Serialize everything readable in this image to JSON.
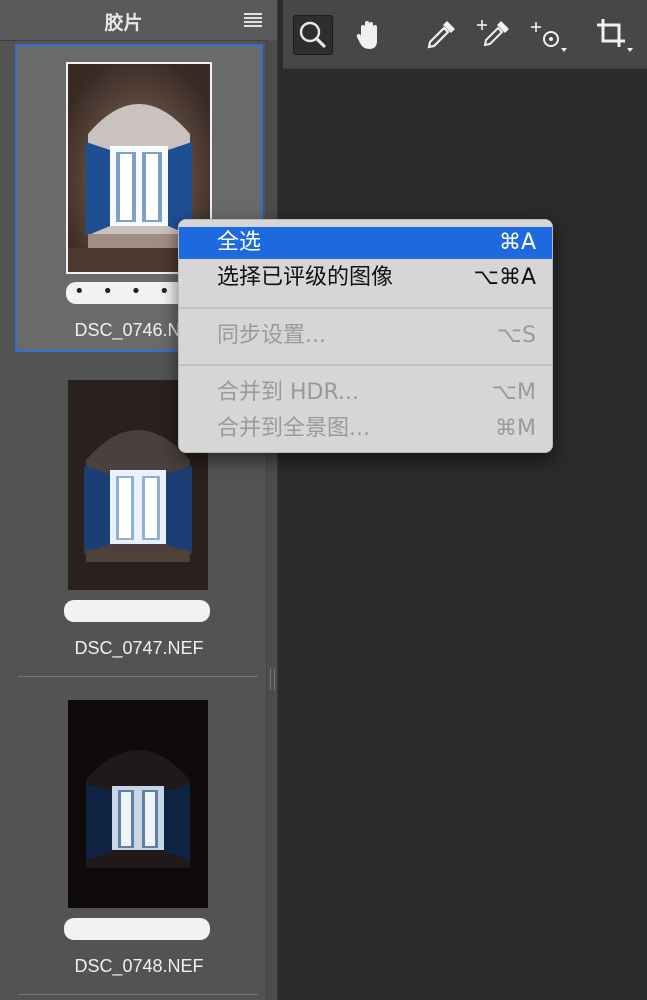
{
  "filmstrip": {
    "title": "胶片",
    "items": [
      {
        "filename": "DSC_0746.NEF",
        "rating": "• • • • •",
        "selected": true
      },
      {
        "filename": "DSC_0747.NEF",
        "rating": "",
        "selected": false
      },
      {
        "filename": "DSC_0748.NEF",
        "rating": "",
        "selected": false
      }
    ]
  },
  "toolbar": {
    "tools": [
      "zoom-icon",
      "hand-icon",
      "eyedropper-icon",
      "color-sampler-icon",
      "target-adjust-icon",
      "crop-icon"
    ],
    "active_tool": "zoom-icon"
  },
  "context_menu": {
    "items": [
      {
        "label": "全选",
        "shortcut": "⌘A",
        "state": "highlighted"
      },
      {
        "label": "选择已评级的图像",
        "shortcut": "⌥⌘A",
        "state": "enabled"
      },
      {
        "label": "同步设置...",
        "shortcut": "⌥S",
        "state": "disabled"
      },
      {
        "label": "合并到 HDR...",
        "shortcut": "⌥M",
        "state": "disabled"
      },
      {
        "label": "合并到全景图...",
        "shortcut": "⌘M",
        "state": "disabled"
      }
    ]
  },
  "colors": {
    "panel_bg": "#535353",
    "canvas_bg": "#2b2b2b",
    "selection_border": "#2f6fd6",
    "menu_highlight": "#1d6ae0"
  }
}
